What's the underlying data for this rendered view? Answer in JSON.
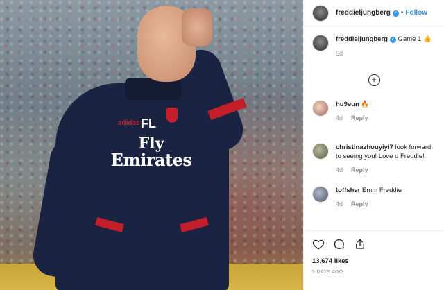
{
  "post": {
    "username": "freddieljungberg",
    "follow_label": "Follow",
    "dot": "•",
    "caption_username": "freddieljungberg",
    "caption_text": " Game 1 👍",
    "caption_time": "5d",
    "likes": "13,674 likes",
    "posted_ago": "5 DAYS AGO"
  },
  "photo": {
    "jersey_initials": "FL",
    "brand_text": "adidas",
    "sponsor_line1": "Fly",
    "sponsor_line2": "Emirates"
  },
  "comments": [
    {
      "username": "hu9eun",
      "text": " 🔥",
      "time": "4d",
      "reply_label": "Reply"
    },
    {
      "username": "christinazhouyiyi7",
      "text": " look forward to seeing you! Love u Freddie!",
      "time": "4d",
      "reply_label": "Reply"
    },
    {
      "username": "toffsher",
      "text": " Emm Freddie",
      "time": "4d",
      "reply_label": "Reply"
    }
  ],
  "icons": {
    "verified": "verified-badge",
    "load_more": "plus-circle-icon",
    "like": "heart-icon",
    "comment": "comment-icon",
    "share": "share-icon"
  },
  "colors": {
    "accent": "#3897f0",
    "text": "#262626",
    "muted": "#8e8e8e",
    "arsenal_red": "#c41e2a",
    "jacket_navy": "#1a2341"
  }
}
